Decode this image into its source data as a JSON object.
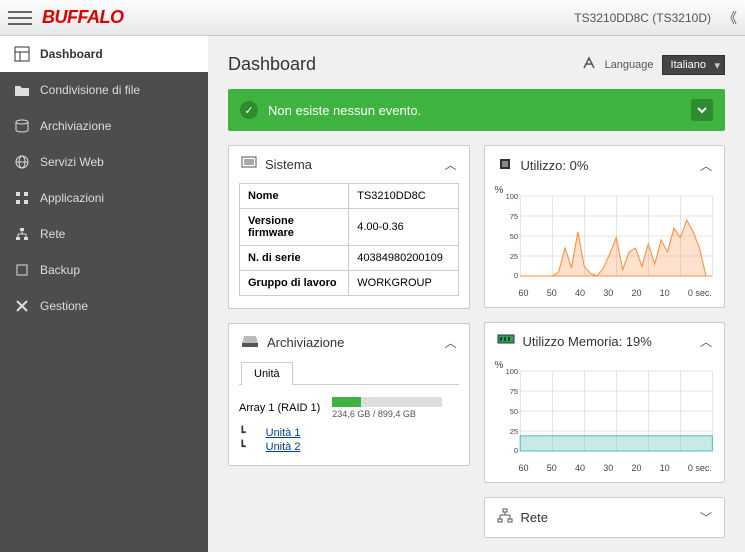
{
  "header": {
    "brand": "BUFFALO",
    "device": "TS3210DD8C (TS3210D)"
  },
  "sidebar": {
    "items": [
      {
        "label": "Dashboard",
        "icon": "dashboard"
      },
      {
        "label": "Condivisione di file",
        "icon": "folder"
      },
      {
        "label": "Archiviazione",
        "icon": "storage"
      },
      {
        "label": "Servizi Web",
        "icon": "web"
      },
      {
        "label": "Applicazioni",
        "icon": "apps"
      },
      {
        "label": "Rete",
        "icon": "network"
      },
      {
        "label": "Backup",
        "icon": "backup"
      },
      {
        "label": "Gestione",
        "icon": "settings"
      }
    ]
  },
  "page": {
    "title": "Dashboard",
    "language_label": "Language",
    "language_value": "Italiano"
  },
  "banner": {
    "text": "Non esiste nessun evento."
  },
  "system": {
    "title": "Sistema",
    "rows": [
      {
        "k": "Nome",
        "v": "TS3210DD8C"
      },
      {
        "k": "Versione firmware",
        "v": "4.00-0.36"
      },
      {
        "k": "N. di serie",
        "v": "40384980200109"
      },
      {
        "k": "Gruppo di lavoro",
        "v": "WORKGROUP"
      }
    ]
  },
  "cpu": {
    "title": "Utilizzo: 0%",
    "y_unit": "%",
    "y_ticks": [
      "100",
      "75",
      "50",
      "25",
      "0"
    ],
    "x_ticks": [
      "60",
      "50",
      "40",
      "30",
      "20",
      "10",
      "0 sec."
    ]
  },
  "storage": {
    "title": "Archiviazione",
    "tab": "Unità",
    "array_label": "Array 1 (RAID 1)",
    "usage_text": "234,6 GB / 899,4 GB",
    "fill_pct": 26,
    "units": [
      "Unità 1",
      "Unità 2"
    ]
  },
  "memory": {
    "title": "Utilizzo Memoria: 19%",
    "y_unit": "%",
    "y_ticks": [
      "100",
      "75",
      "50",
      "25",
      "0"
    ],
    "x_ticks": [
      "60",
      "50",
      "40",
      "30",
      "20",
      "10",
      "0 sec."
    ],
    "fill_pct": 19
  },
  "network": {
    "title": "Rete"
  },
  "chart_data": [
    {
      "type": "area",
      "title": "Utilizzo: 0%",
      "xlabel": "sec.",
      "ylabel": "%",
      "ylim": [
        0,
        100
      ],
      "x": [
        60,
        58,
        56,
        54,
        52,
        50,
        48,
        46,
        44,
        42,
        40,
        38,
        36,
        34,
        32,
        30,
        28,
        26,
        24,
        22,
        20,
        18,
        16,
        14,
        12,
        10,
        8,
        6,
        4,
        2,
        0
      ],
      "series": [
        {
          "name": "cpu",
          "values": [
            0,
            0,
            0,
            0,
            0,
            0,
            5,
            35,
            10,
            55,
            12,
            3,
            0,
            10,
            28,
            48,
            8,
            30,
            35,
            12,
            40,
            15,
            45,
            30,
            60,
            48,
            70,
            55,
            35,
            0,
            0
          ]
        }
      ]
    },
    {
      "type": "area",
      "title": "Utilizzo Memoria: 19%",
      "xlabel": "sec.",
      "ylabel": "%",
      "ylim": [
        0,
        100
      ],
      "x": [
        60,
        50,
        40,
        30,
        20,
        10,
        0
      ],
      "series": [
        {
          "name": "memory",
          "values": [
            19,
            19,
            19,
            19,
            19,
            19,
            19
          ]
        }
      ]
    }
  ]
}
